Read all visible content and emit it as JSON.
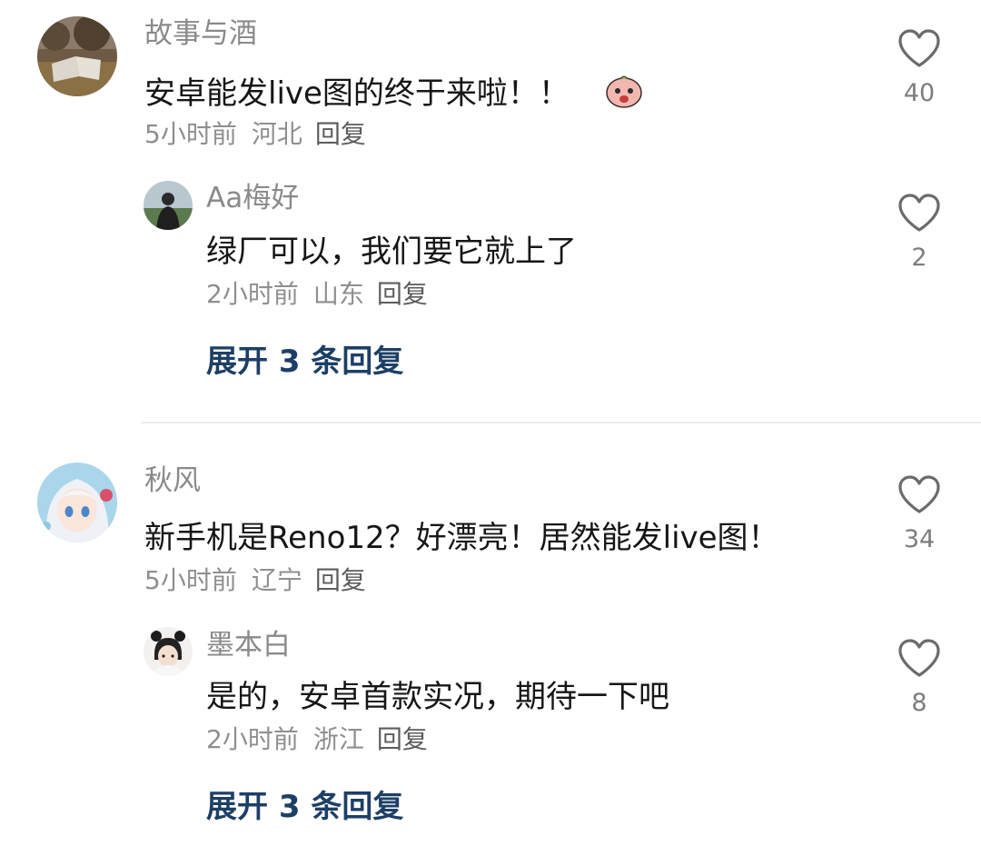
{
  "comments": [
    {
      "author": "故事与酒",
      "text": "安卓能发live图的终于来啦！！",
      "emoji_icon": "surprised-peach-emoji-icon",
      "time": "5小时前",
      "location": "河北",
      "reply_label": "回复",
      "likes": "40",
      "replies": [
        {
          "author": "Aa梅好",
          "text": "绿厂可以，我们要它就上了",
          "time": "2小时前",
          "location": "山东",
          "reply_label": "回复",
          "likes": "2"
        }
      ],
      "expand_label": "展开 3 条回复"
    },
    {
      "author": "秋风",
      "text": "新手机是Reno12？好漂亮！居然能发live图！",
      "time": "5小时前",
      "location": "辽宁",
      "reply_label": "回复",
      "likes": "34",
      "replies": [
        {
          "author": "墨本白",
          "text": "是的，安卓首款实况，期待一下吧",
          "time": "2小时前",
          "location": "浙江",
          "reply_label": "回复",
          "likes": "8"
        }
      ],
      "expand_label": "展开 3 条回复"
    }
  ],
  "icons": {
    "like": "heart-outline-icon"
  },
  "colors": {
    "expand_link": "#1d3f66",
    "meta_text": "#8f8f8f",
    "author_text": "#8a8a8a",
    "divider": "#ececec"
  }
}
